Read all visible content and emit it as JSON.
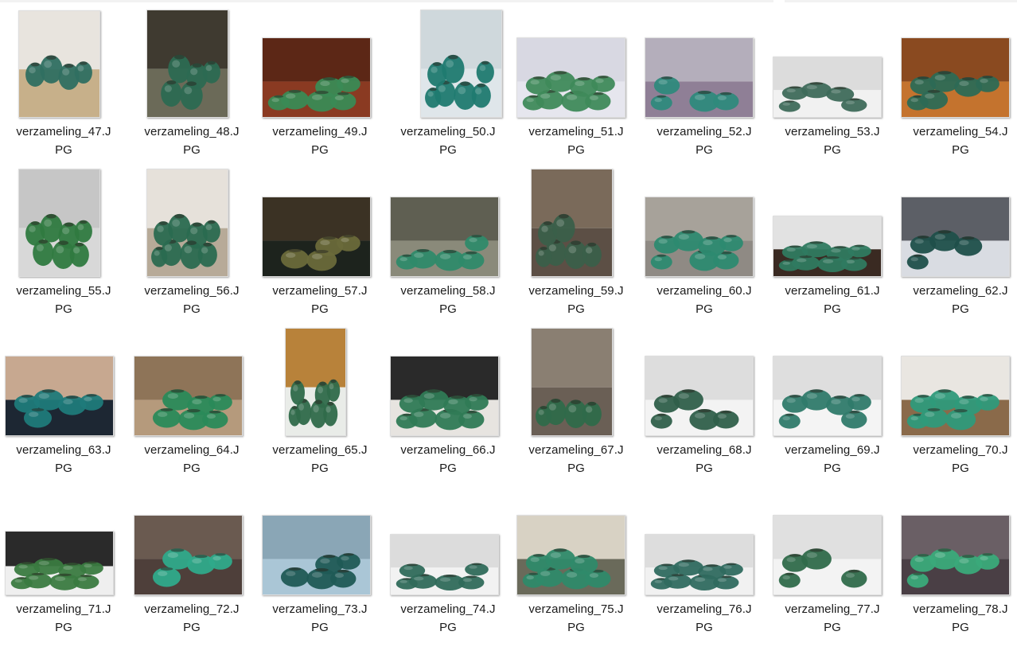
{
  "items": [
    {
      "line1": "verzameling_47.J",
      "line2": "PG",
      "colors": [
        "#c7b08a",
        "#e8e4de",
        "#2f6f61"
      ]
    },
    {
      "line1": "verzameling_48.J",
      "line2": "PG",
      "colors": [
        "#6b6a58",
        "#3f3a30",
        "#2c6a52"
      ]
    },
    {
      "line1": "verzameling_49.J",
      "line2": "PG",
      "colors": [
        "#8a3a22",
        "#5c2716",
        "#3a8a55"
      ]
    },
    {
      "line1": "verzameling_50.J",
      "line2": "PG",
      "colors": [
        "#dfe6ea",
        "#cfd8dc",
        "#1f7a70"
      ]
    },
    {
      "line1": "verzameling_51.J",
      "line2": "PG",
      "colors": [
        "#e6e6ee",
        "#d8d8e2",
        "#3f8a5a"
      ]
    },
    {
      "line1": "verzameling_52.J",
      "line2": "PG",
      "colors": [
        "#8f7f96",
        "#b4aebb",
        "#2f8a7c"
      ]
    },
    {
      "line1": "verzameling_53.J",
      "line2": "PG",
      "colors": [
        "#f1f1f1",
        "#dcdcdc",
        "#3e6a5a"
      ]
    },
    {
      "line1": "verzameling_54.J",
      "line2": "PG",
      "colors": [
        "#c4732e",
        "#8a4a20",
        "#2d6a55"
      ]
    },
    {
      "line1": "verzameling_55.J",
      "line2": "PG",
      "colors": [
        "#d8d8d8",
        "#c6c6c6",
        "#2f7a40"
      ]
    },
    {
      "line1": "verzameling_56.J",
      "line2": "PG",
      "colors": [
        "#b7aa98",
        "#e6e1da",
        "#2a6a50"
      ]
    },
    {
      "line1": "verzameling_57.J",
      "line2": "PG",
      "colors": [
        "#1d231d",
        "#3b3224",
        "#6a6a3a"
      ]
    },
    {
      "line1": "verzameling_58.J",
      "line2": "PG",
      "colors": [
        "#8a8a7a",
        "#5f5f52",
        "#2f8a6a"
      ]
    },
    {
      "line1": "verzameling_59.J",
      "line2": "PG",
      "colors": [
        "#5c4f45",
        "#7a6a5a",
        "#3a5f4a"
      ]
    },
    {
      "line1": "verzameling_60.J",
      "line2": "PG",
      "colors": [
        "#8f8a84",
        "#a7a29a",
        "#2d8a70"
      ]
    },
    {
      "line1": "verzameling_61.J",
      "line2": "PG",
      "colors": [
        "#3a2a22",
        "#e2e2e2",
        "#2f7a60"
      ]
    },
    {
      "line1": "verzameling_62.J",
      "line2": "PG",
      "colors": [
        "#d9dce2",
        "#5c5f66",
        "#1f4f4a"
      ]
    },
    {
      "line1": "verzameling_63.J",
      "line2": "PG",
      "colors": [
        "#1d2733",
        "#c7a890",
        "#1f7a7a"
      ]
    },
    {
      "line1": "verzameling_64.J",
      "line2": "PG",
      "colors": [
        "#b59a7c",
        "#8e7458",
        "#2a8a5a"
      ]
    },
    {
      "line1": "verzameling_65.J",
      "line2": "PG",
      "colors": [
        "#e9ece8",
        "#b8823a",
        "#2f6a4a"
      ]
    },
    {
      "line1": "verzameling_66.J",
      "line2": "PG",
      "colors": [
        "#e7e4e0",
        "#2a2a2a",
        "#2f7a55"
      ]
    },
    {
      "line1": "verzameling_67.J",
      "line2": "PG",
      "colors": [
        "#6a5f55",
        "#8a7f72",
        "#2f6a4a"
      ]
    },
    {
      "line1": "verzameling_68.J",
      "line2": "PG",
      "colors": [
        "#f3f3f3",
        "#dddddd",
        "#2f5f4a"
      ]
    },
    {
      "line1": "verzameling_69.J",
      "line2": "PG",
      "colors": [
        "#f4f4f4",
        "#dedede",
        "#2f7a6a"
      ]
    },
    {
      "line1": "verzameling_70.J",
      "line2": "PG",
      "colors": [
        "#8a6a4a",
        "#e9e6e1",
        "#2f9a7a"
      ]
    },
    {
      "line1": "verzameling_71.J",
      "line2": "PG",
      "colors": [
        "#efefef",
        "#2a2a2a",
        "#3a7a40"
      ]
    },
    {
      "line1": "verzameling_72.J",
      "line2": "PG",
      "colors": [
        "#4e3f3a",
        "#6a5a50",
        "#2faa8a"
      ]
    },
    {
      "line1": "verzameling_73.J",
      "line2": "PG",
      "colors": [
        "#aac6d6",
        "#8aa6b6",
        "#1f5a55"
      ]
    },
    {
      "line1": "verzameling_74.J",
      "line2": "PG",
      "colors": [
        "#f2f2f2",
        "#dcdcdc",
        "#2f6a5a"
      ]
    },
    {
      "line1": "verzameling_75.J",
      "line2": "PG",
      "colors": [
        "#6a6a5a",
        "#d8d2c4",
        "#2f8a6a"
      ]
    },
    {
      "line1": "verzameling_76.J",
      "line2": "PG",
      "colors": [
        "#f1f1f1",
        "#dddddd",
        "#2f6a5f"
      ]
    },
    {
      "line1": "verzameling_77.J",
      "line2": "PG",
      "colors": [
        "#f3f3f3",
        "#e0e0e0",
        "#2f6a4a"
      ]
    },
    {
      "line1": "verzameling_78.J",
      "line2": "PG",
      "colors": [
        "#4a3f45",
        "#6a5f65",
        "#3aaa7a"
      ]
    }
  ]
}
